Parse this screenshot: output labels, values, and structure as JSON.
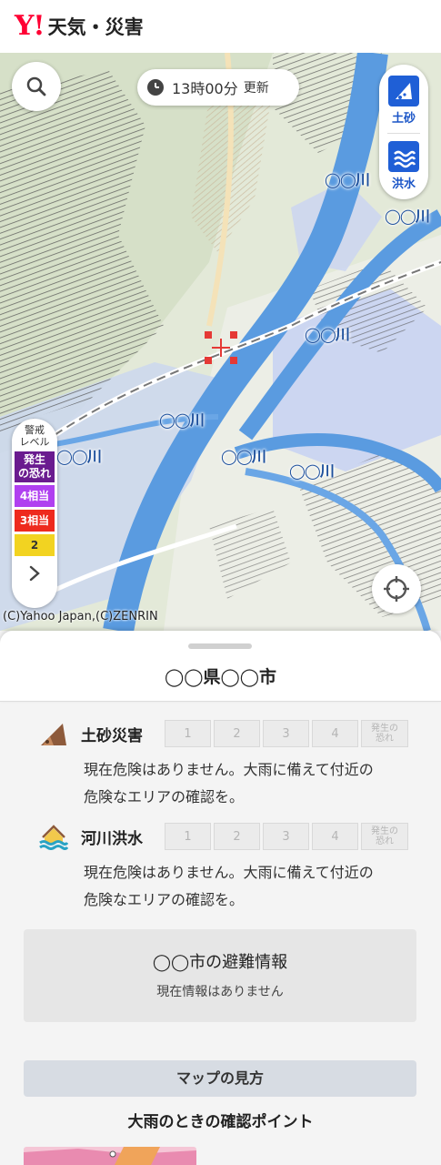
{
  "header": {
    "logo": "Y!",
    "title": "天気・災害"
  },
  "map": {
    "update_time": "13時00分",
    "update_label": "更新",
    "layers": [
      {
        "label": "土砂",
        "icon": "landslide-layer-icon"
      },
      {
        "label": "洪水",
        "icon": "flood-layer-icon"
      }
    ],
    "legend": {
      "title_line1": "警戒",
      "title_line2": "レベル",
      "levels": [
        {
          "label_line1": "発生",
          "label_line2": "の恐れ",
          "color": "#6a1b8f"
        },
        {
          "label": "4相当",
          "color": "#b040f0"
        },
        {
          "label": "3相当",
          "color": "#ee2a1e"
        },
        {
          "label": "2",
          "color": "#f2d321"
        }
      ]
    },
    "river_labels": [
      "◯◯川",
      "◯◯川",
      "◯◯川",
      "◯◯川",
      "◯◯川",
      "◯◯川",
      "◯◯川"
    ],
    "copyright": "(C)Yahoo Japan,(C)ZENRIN"
  },
  "sheet": {
    "region": "◯◯県◯◯市",
    "risks": [
      {
        "name": "土砂災害",
        "levels": [
          "1",
          "2",
          "3",
          "4"
        ],
        "top_level_line1": "発生の",
        "top_level_line2": "恐れ",
        "desc_line1": "現在危険はありません。大雨に備えて付近の",
        "desc_line2": "危険なエリアの確認を。"
      },
      {
        "name": "河川洪水",
        "levels": [
          "1",
          "2",
          "3",
          "4"
        ],
        "top_level_line1": "発生の",
        "top_level_line2": "恐れ",
        "desc_line1": "現在危険はありません。大雨に備えて付近の",
        "desc_line2": "危険なエリアの確認を。"
      }
    ],
    "evacuation": {
      "title": "◯◯市の避難情報",
      "status": "現在情報はありません"
    },
    "howto_button": "マップの見方",
    "points_title": "大雨のときの確認ポイント"
  }
}
